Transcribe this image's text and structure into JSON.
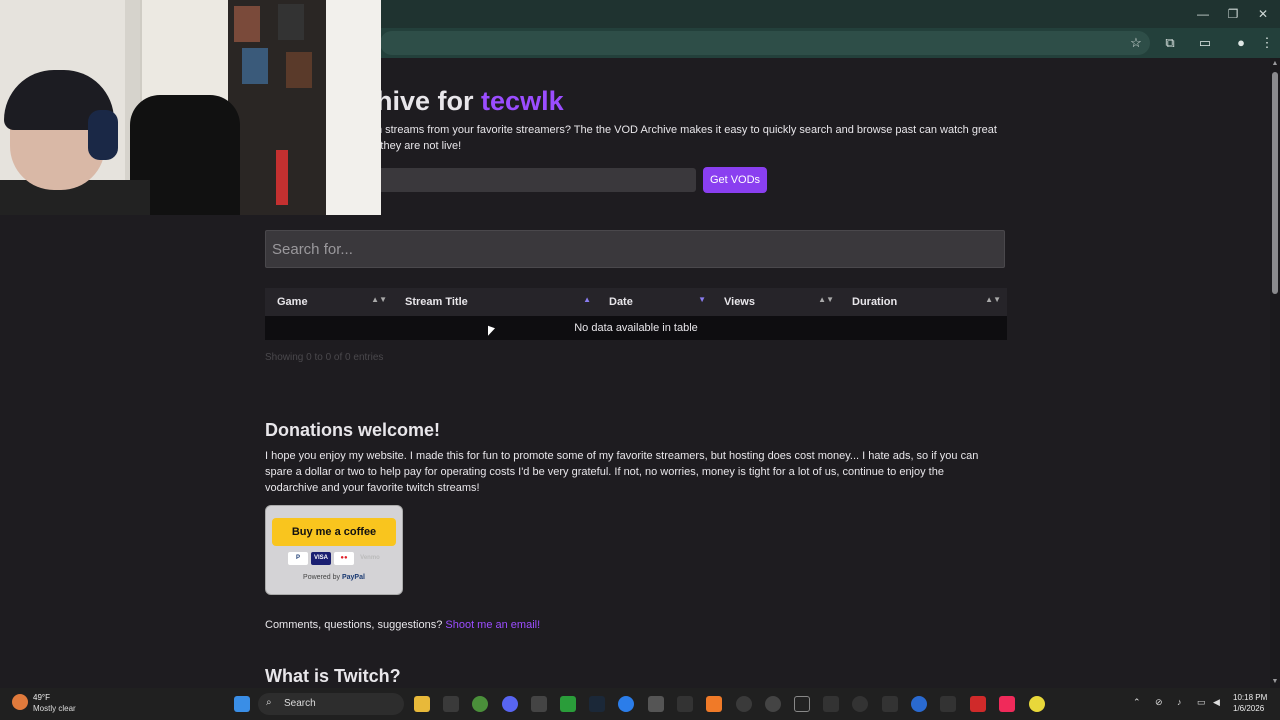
{
  "browser": {
    "window_controls": {
      "minimize": "—",
      "maximize": "❐",
      "close": "✕"
    },
    "toolbar_icons": [
      "star-icon",
      "extensions-icon",
      "cast-icon",
      "profile-icon",
      "menu-icon"
    ]
  },
  "header": {
    "title_prefix": "OD Archive for ",
    "title_user": "tecwlk",
    "intro": "usly recorded Twitch streams from your favorite streamers? The the VOD Archive makes it easy to quickly search and browse past can watch great streams even when they are not live!",
    "channel_input_placeholder": "e",
    "get_vods_label": "Get VODs"
  },
  "search": {
    "placeholder": "Search for..."
  },
  "table": {
    "columns": [
      "Game",
      "Stream Title",
      "Date",
      "Views",
      "Duration"
    ],
    "empty_message": "No data available in table",
    "info": "Showing 0 to 0 of 0 entries"
  },
  "donations": {
    "title": "Donations welcome!",
    "text": "I hope you enjoy my website. I made this for fun to promote some of my favorite streamers, but hosting does cost money... I hate ads, so if you can spare a dollar or two to help pay for operating costs I'd be very grateful. If not, no worries, money is tight for a lot of us, continue to enjoy the vodarchive and your favorite twitch streams!",
    "coffee_button": "Buy me a coffee",
    "cards": [
      "P",
      "VISA",
      "●●",
      "Venmo"
    ],
    "powered_by_prefix": "Powered by ",
    "powered_by_brand": "PayPal"
  },
  "contact": {
    "text": "Comments, questions, suggestions? ",
    "link": "Shoot me an email!"
  },
  "twitch_section": {
    "title": "What is Twitch?"
  },
  "taskbar": {
    "weather_temp": "49°F",
    "weather_desc": "Mostly clear",
    "search_label": "Search",
    "time": "10:18 PM",
    "date": "1/6/2026",
    "tray_icons": [
      "chevron-up-icon",
      "network-off-icon",
      "mic-icon",
      "display-icon",
      "volume-icon"
    ]
  },
  "colors": {
    "accent_purple": "#9b4dff",
    "button_purple": "#8a3ff0",
    "coffee_yellow": "#f9c51e"
  }
}
